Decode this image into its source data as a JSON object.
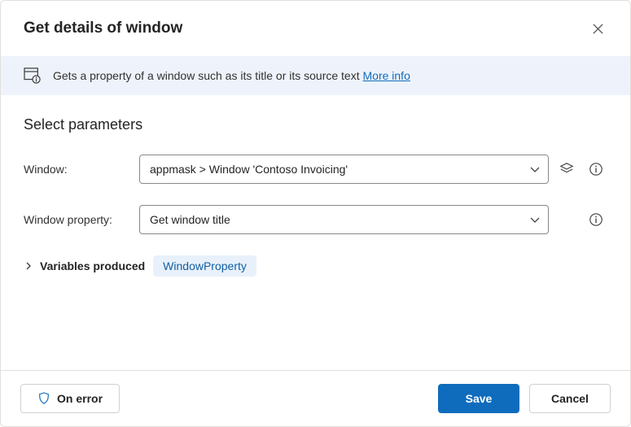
{
  "header": {
    "title": "Get details of window"
  },
  "info": {
    "text": "Gets a property of a window such as its title or its source text",
    "more_label": "More info"
  },
  "section_title": "Select parameters",
  "fields": {
    "window": {
      "label": "Window:",
      "value": "appmask > Window 'Contoso Invoicing'"
    },
    "property": {
      "label": "Window property:",
      "value": "Get window title"
    }
  },
  "variables": {
    "label": "Variables produced",
    "chip": "WindowProperty"
  },
  "footer": {
    "on_error": "On error",
    "save": "Save",
    "cancel": "Cancel"
  }
}
